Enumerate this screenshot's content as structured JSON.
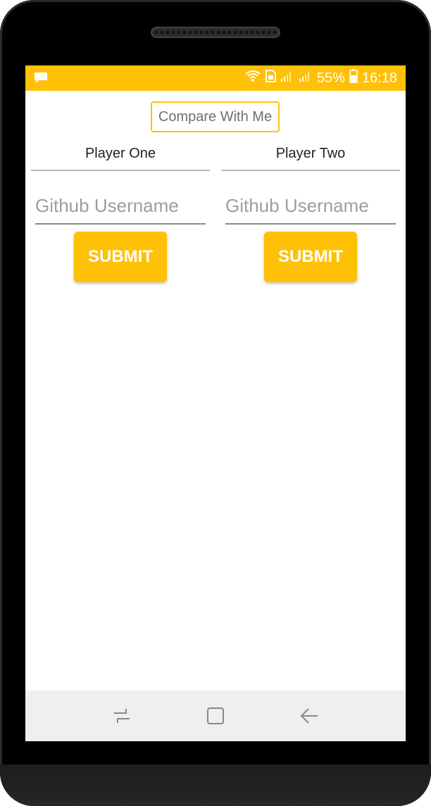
{
  "status_bar": {
    "notification_icon": "message-icon",
    "battery_percent": "55%",
    "time": "16:18",
    "icons": [
      "wifi-icon",
      "sim-icon",
      "signal-icon",
      "signal-icon",
      "battery-icon"
    ]
  },
  "header": {
    "compare_label": "Compare With Me"
  },
  "players": [
    {
      "label": "Player One",
      "input_placeholder": "Github Username",
      "input_value": "",
      "submit_label": "SUBMIT"
    },
    {
      "label": "Player Two",
      "input_placeholder": "Github Username",
      "input_value": "",
      "submit_label": "SUBMIT"
    }
  ],
  "nav_bar": {
    "icons": [
      "recent-apps-icon",
      "home-icon",
      "back-icon"
    ]
  },
  "colors": {
    "accent": "#ffc107",
    "nav_bg": "#efefef"
  }
}
